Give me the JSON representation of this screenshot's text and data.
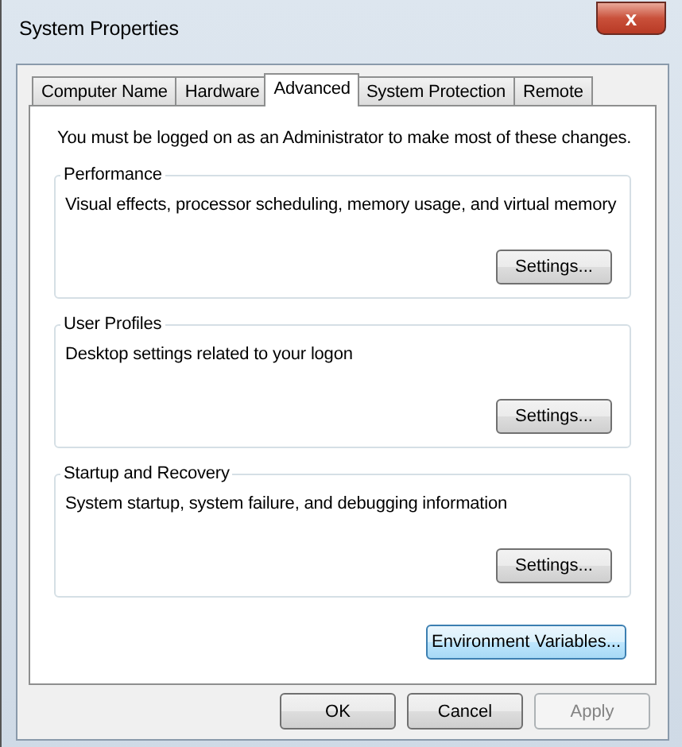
{
  "window": {
    "title": "System Properties",
    "close_label": "x"
  },
  "tabs": [
    {
      "label": "Computer Name",
      "selected": false
    },
    {
      "label": "Hardware",
      "selected": false
    },
    {
      "label": "Advanced",
      "selected": true
    },
    {
      "label": "System Protection",
      "selected": false
    },
    {
      "label": "Remote",
      "selected": false
    }
  ],
  "notice": "You must be logged on as an Administrator to make most of these changes.",
  "groups": [
    {
      "title": "Performance",
      "description": "Visual effects, processor scheduling, memory usage, and virtual memory",
      "button": "Settings..."
    },
    {
      "title": "User Profiles",
      "description": "Desktop settings related to your logon",
      "button": "Settings..."
    },
    {
      "title": "Startup and Recovery",
      "description": "System startup, system failure, and debugging information",
      "button": "Settings..."
    }
  ],
  "environment_button": {
    "label": "Environment Variables...",
    "focused": true
  },
  "buttons": [
    {
      "label": "OK",
      "disabled": false
    },
    {
      "label": "Cancel",
      "disabled": false
    },
    {
      "label": "Apply",
      "disabled": true
    }
  ]
}
